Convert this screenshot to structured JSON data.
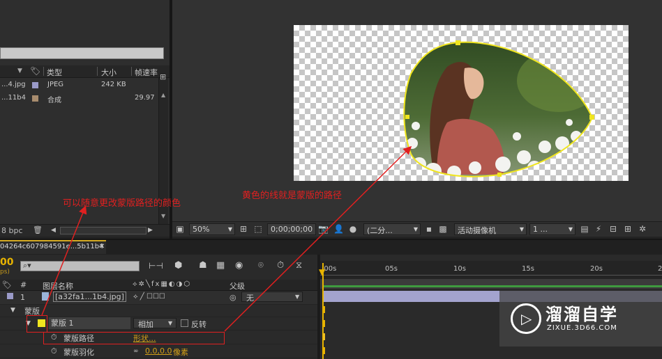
{
  "project": {
    "columns": {
      "type": "类型",
      "size": "大小",
      "framerate": "帧速率"
    },
    "items": [
      {
        "name": "...4.jpg",
        "type": "JPEG",
        "size": "242 KB",
        "framerate": "",
        "color": "#9a9ac8"
      },
      {
        "name": "...11b4",
        "type": "合成",
        "size": "",
        "framerate": "29.97",
        "color": "#a88c6e"
      }
    ],
    "footer_bpc": "8 bpc"
  },
  "viewer": {
    "zoom": "50%",
    "timecode": "0;00;00;00",
    "resolution": "(二分...",
    "camera": "活动摄像机",
    "views": "1 ..."
  },
  "timeline": {
    "tab_label": "04264c607984591e...5b11b4",
    "timecode": "00",
    "timecode_sub": "ps)",
    "columns": {
      "number": "#",
      "layer_name": "图层名称",
      "parent": "父级"
    },
    "ruler_ticks": [
      ":00s",
      "05s",
      "10s",
      "15s",
      "20s",
      "2"
    ],
    "layer": {
      "number": "1",
      "name": "[a32fa1...1b4.jpg]",
      "parent": "无"
    },
    "masks_label": "蒙版",
    "mask": {
      "name": "蒙版 1",
      "mode": "相加",
      "invert_label": "反转"
    },
    "mask_path": {
      "label": "蒙版路径",
      "value": "形状..."
    },
    "mask_feather": {
      "label": "蒙版羽化",
      "value": "0.0,0.0",
      "unit": "像素"
    }
  },
  "annotations": {
    "color_note": "可以随意更改蒙版路径的颜色",
    "path_note": "黄色的线就是蒙版的路径"
  },
  "watermark": {
    "title": "溜溜自学",
    "subtitle": "ZIXUE.3D66.COM"
  },
  "colors": {
    "mask_path": "#f0e51f",
    "annotation": "#e02020",
    "accent": "#e8b400",
    "layer_bar": "#a3a3ce"
  }
}
